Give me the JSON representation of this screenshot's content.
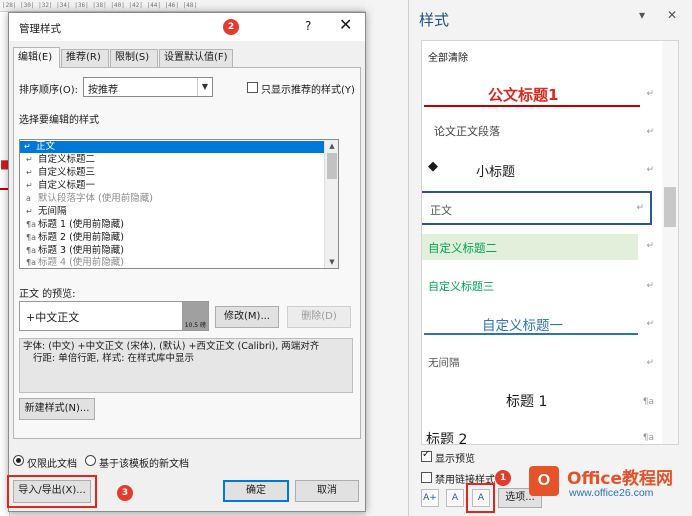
{
  "ruler": {
    "text": "|28|  |30|  |32|  |34|  |36|  |38|  |40|  |42|  |44|  |46|  |48|"
  },
  "dialog": {
    "title": "管理样式",
    "help": "?",
    "close": "✕",
    "badge_title": "2",
    "tabs": [
      "编辑(E)",
      "推荐(R)",
      "限制(S)",
      "设置默认值(F)"
    ],
    "sort_label": "排序顺序(O):",
    "sort_value": "按推荐",
    "show_recommended": "只显示推荐的样式(Y)",
    "select_label": "选择要编辑的样式",
    "style_list": [
      {
        "icon": "↵",
        "text": "正文"
      },
      {
        "icon": "↵",
        "text": "自定义标题二"
      },
      {
        "icon": "↵",
        "text": "自定义标题三"
      },
      {
        "icon": "↵",
        "text": "自定义标题一"
      },
      {
        "icon": "a",
        "text": "默认段落字体  (使用前隐藏)"
      },
      {
        "icon": "↵",
        "text": "无间隔"
      },
      {
        "icon": "¶a",
        "text": "标题 1  (使用前隐藏)"
      },
      {
        "icon": "¶a",
        "text": "标题 2  (使用前隐藏)"
      },
      {
        "icon": "¶a",
        "text": "标题 3  (使用前隐藏)"
      },
      {
        "icon": "¶a",
        "text": "标题 4  (使用前隐藏)"
      }
    ],
    "preview_label": "正文 的预览:",
    "preview_text": "+中文正文",
    "preview_size": "10.5 磅",
    "modify_button": "修改(M)...",
    "delete_button": "删除(D)",
    "description_line1": "字体: (中文) +中文正文 (宋体), (默认) +西文正文 (Calibri), 两端对齐",
    "description_line2": "行距: 单倍行距, 样式: 在样式库中显示",
    "new_style_button": "新建样式(N)...",
    "radio_doc": "仅限此文档",
    "radio_template": "基于该模板的新文档",
    "import_export_button": "导入/导出(X)...",
    "badge_import": "3",
    "ok_button": "确定",
    "cancel_button": "取消"
  },
  "pane": {
    "title": "样式",
    "dropdown": "▾",
    "close": "✕",
    "clear_all": "全部清除",
    "items": [
      {
        "text": "公文标题1",
        "mark": "↵"
      },
      {
        "text": "论文正文段落",
        "mark": "↵"
      },
      {
        "text": "小标题",
        "mark": "↵"
      },
      {
        "text": "正文",
        "mark": "↵"
      },
      {
        "text": "自定义标题二",
        "mark": "↵"
      },
      {
        "text": "自定义标题三",
        "mark": "↵"
      },
      {
        "text": "自定义标题一",
        "mark": "↵"
      },
      {
        "text": "无间隔",
        "mark": "↵"
      },
      {
        "text": "标题 1",
        "mark": "¶a"
      },
      {
        "text": "标题 2",
        "mark": "¶a"
      }
    ],
    "bullet": "◆",
    "show_preview": "显示预览",
    "disable_linked": "禁用链接样式",
    "badge_manage": "1",
    "options_button": "选项...",
    "tool_new": "A+",
    "tool_inspect": "A",
    "tool_manage": "A"
  },
  "watermark": {
    "logo": "O",
    "title": "Office教程网",
    "url": "www.office26.com"
  },
  "colors": {
    "accent": "#0078d7",
    "highlight_red": "#e0271e",
    "heading_red": "#c00000",
    "green": "#00b050",
    "blue_heading": "#2e74b5"
  }
}
